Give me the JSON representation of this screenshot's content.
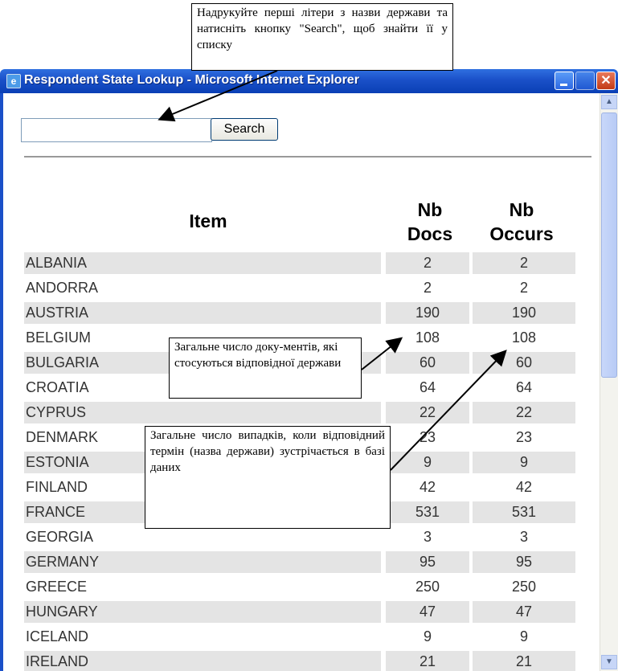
{
  "annotations": {
    "top_note": "Надрукуйте перші літери з назви держави та натисніть кнопку \"Search\", щоб знайти її у списку",
    "docs_note": "Загальне число доку-ментів, які стосуються відповідної держави",
    "occurs_note": "Загальне число випадків, коли відповідний термін (назва держави) зустрічається в базі даних"
  },
  "window": {
    "title": "Respondent State Lookup - Microsoft Internet Explorer",
    "close_glyph": "✕"
  },
  "search": {
    "value": "",
    "placeholder": "",
    "button_label": "Search"
  },
  "table": {
    "headers": {
      "item": "Item",
      "docs_line1": "Nb",
      "docs_line2": "Docs",
      "occurs_line1": "Nb",
      "occurs_line2": "Occurs"
    },
    "rows": [
      {
        "name": "ALBANIA",
        "docs": "2",
        "occurs": "2"
      },
      {
        "name": "ANDORRA",
        "docs": "2",
        "occurs": "2"
      },
      {
        "name": "AUSTRIA",
        "docs": "190",
        "occurs": "190"
      },
      {
        "name": "BELGIUM",
        "docs": "108",
        "occurs": "108"
      },
      {
        "name": "BULGARIA",
        "docs": "60",
        "occurs": "60"
      },
      {
        "name": "CROATIA",
        "docs": "64",
        "occurs": "64"
      },
      {
        "name": "CYPRUS",
        "docs": "22",
        "occurs": "22"
      },
      {
        "name": "DENMARK",
        "docs": "23",
        "occurs": "23"
      },
      {
        "name": "ESTONIA",
        "docs": "9",
        "occurs": "9"
      },
      {
        "name": "FINLAND",
        "docs": "42",
        "occurs": "42"
      },
      {
        "name": "FRANCE",
        "docs": "531",
        "occurs": "531"
      },
      {
        "name": "GEORGIA",
        "docs": "3",
        "occurs": "3"
      },
      {
        "name": "GERMANY",
        "docs": "95",
        "occurs": "95"
      },
      {
        "name": "GREECE",
        "docs": "250",
        "occurs": "250"
      },
      {
        "name": "HUNGARY",
        "docs": "47",
        "occurs": "47"
      },
      {
        "name": "ICELAND",
        "docs": "9",
        "occurs": "9"
      },
      {
        "name": "IRELAND",
        "docs": "21",
        "occurs": "21"
      }
    ]
  },
  "icons": {
    "app": "ie-page-icon",
    "minimize": "minimize-icon",
    "maximize": "maximize-icon",
    "close": "close-icon"
  }
}
